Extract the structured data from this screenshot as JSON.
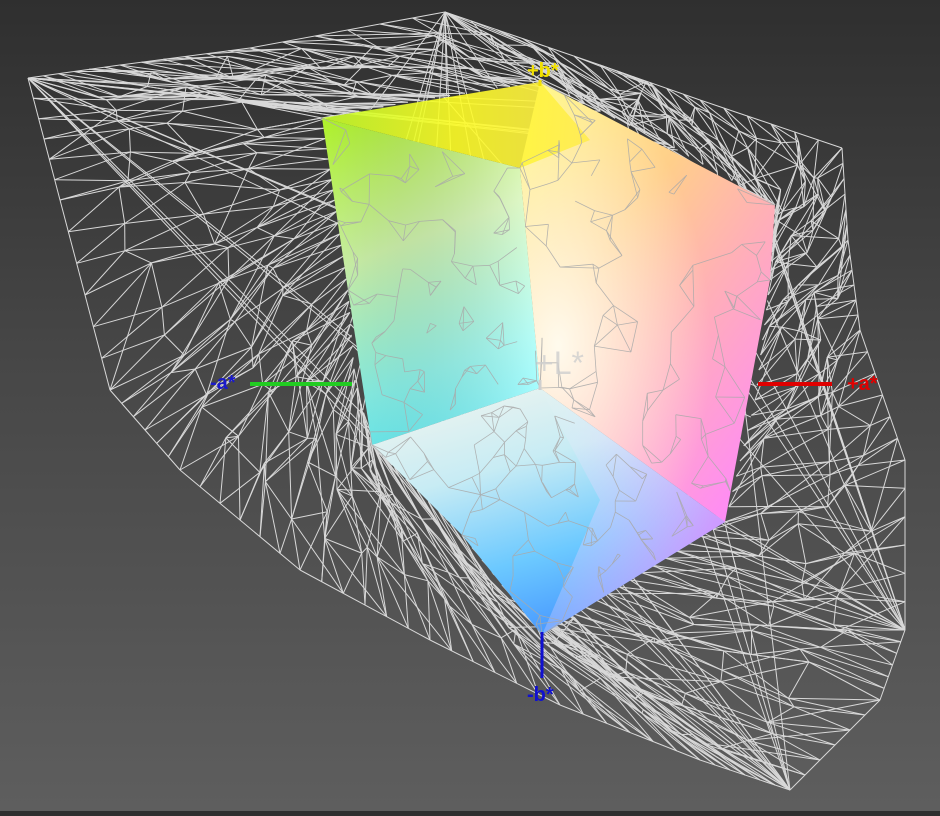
{
  "axes": {
    "plus_b": {
      "label": "+b*",
      "color": "#f2e000"
    },
    "minus_b": {
      "label": "-b*",
      "color": "#1010d0"
    },
    "plus_a": {
      "label": "+a*",
      "color": "#e00000"
    },
    "minus_a": {
      "label": "-a*",
      "color": "#1a1acc",
      "line_color": "#22cc22"
    },
    "plus_l": {
      "label": "+L*",
      "color": "#cfcfcf"
    }
  },
  "colors": {
    "wireframe": "#d8d8d8",
    "background_top": "#2f2f2f",
    "background_bottom": "#5e5e5e"
  }
}
